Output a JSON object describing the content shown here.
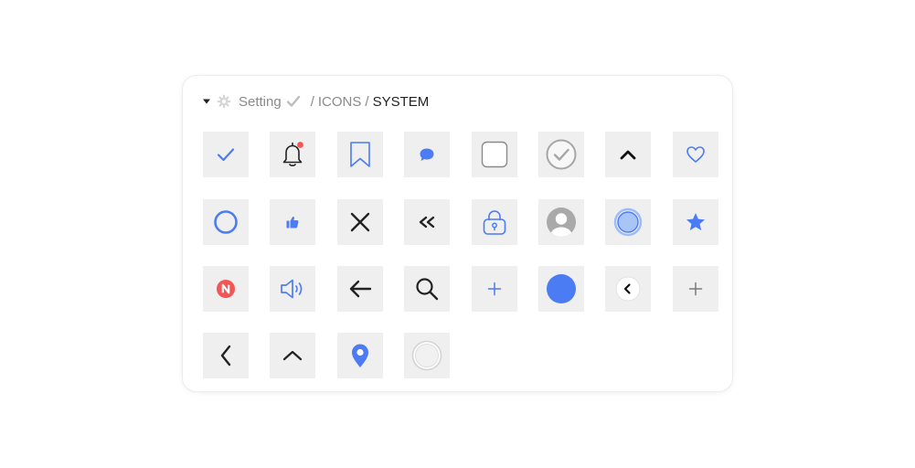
{
  "breadcrumb": {
    "root": "Setting",
    "separator": "/",
    "section": "ICONS",
    "current": "SYSTEM"
  },
  "colors": {
    "accent": "#4c7cf3",
    "tile_background": "#efefef",
    "badge_red": "#f25656",
    "muted": "#a0a0a0",
    "text_dark": "#222222"
  },
  "icons": [
    "check-icon",
    "notification-bell-icon",
    "bookmark-icon",
    "chat-bubble-icon",
    "checkbox-icon",
    "check-circle-icon",
    "chevron-up-icon",
    "heart-icon",
    "radio-circle-icon",
    "thumbs-up-icon",
    "close-icon",
    "double-chevron-left-icon",
    "lock-icon",
    "avatar-icon",
    "selected-radio-icon",
    "star-icon",
    "new-badge-icon",
    "speaker-icon",
    "arrow-left-icon",
    "search-icon",
    "plus-icon",
    "filled-circle-icon",
    "back-circle-button-icon",
    "plus-icon",
    "chevron-left-icon",
    "chevron-up-icon",
    "location-pin-icon",
    "empty-radio-icon"
  ],
  "badge": {
    "new_label": "N"
  }
}
